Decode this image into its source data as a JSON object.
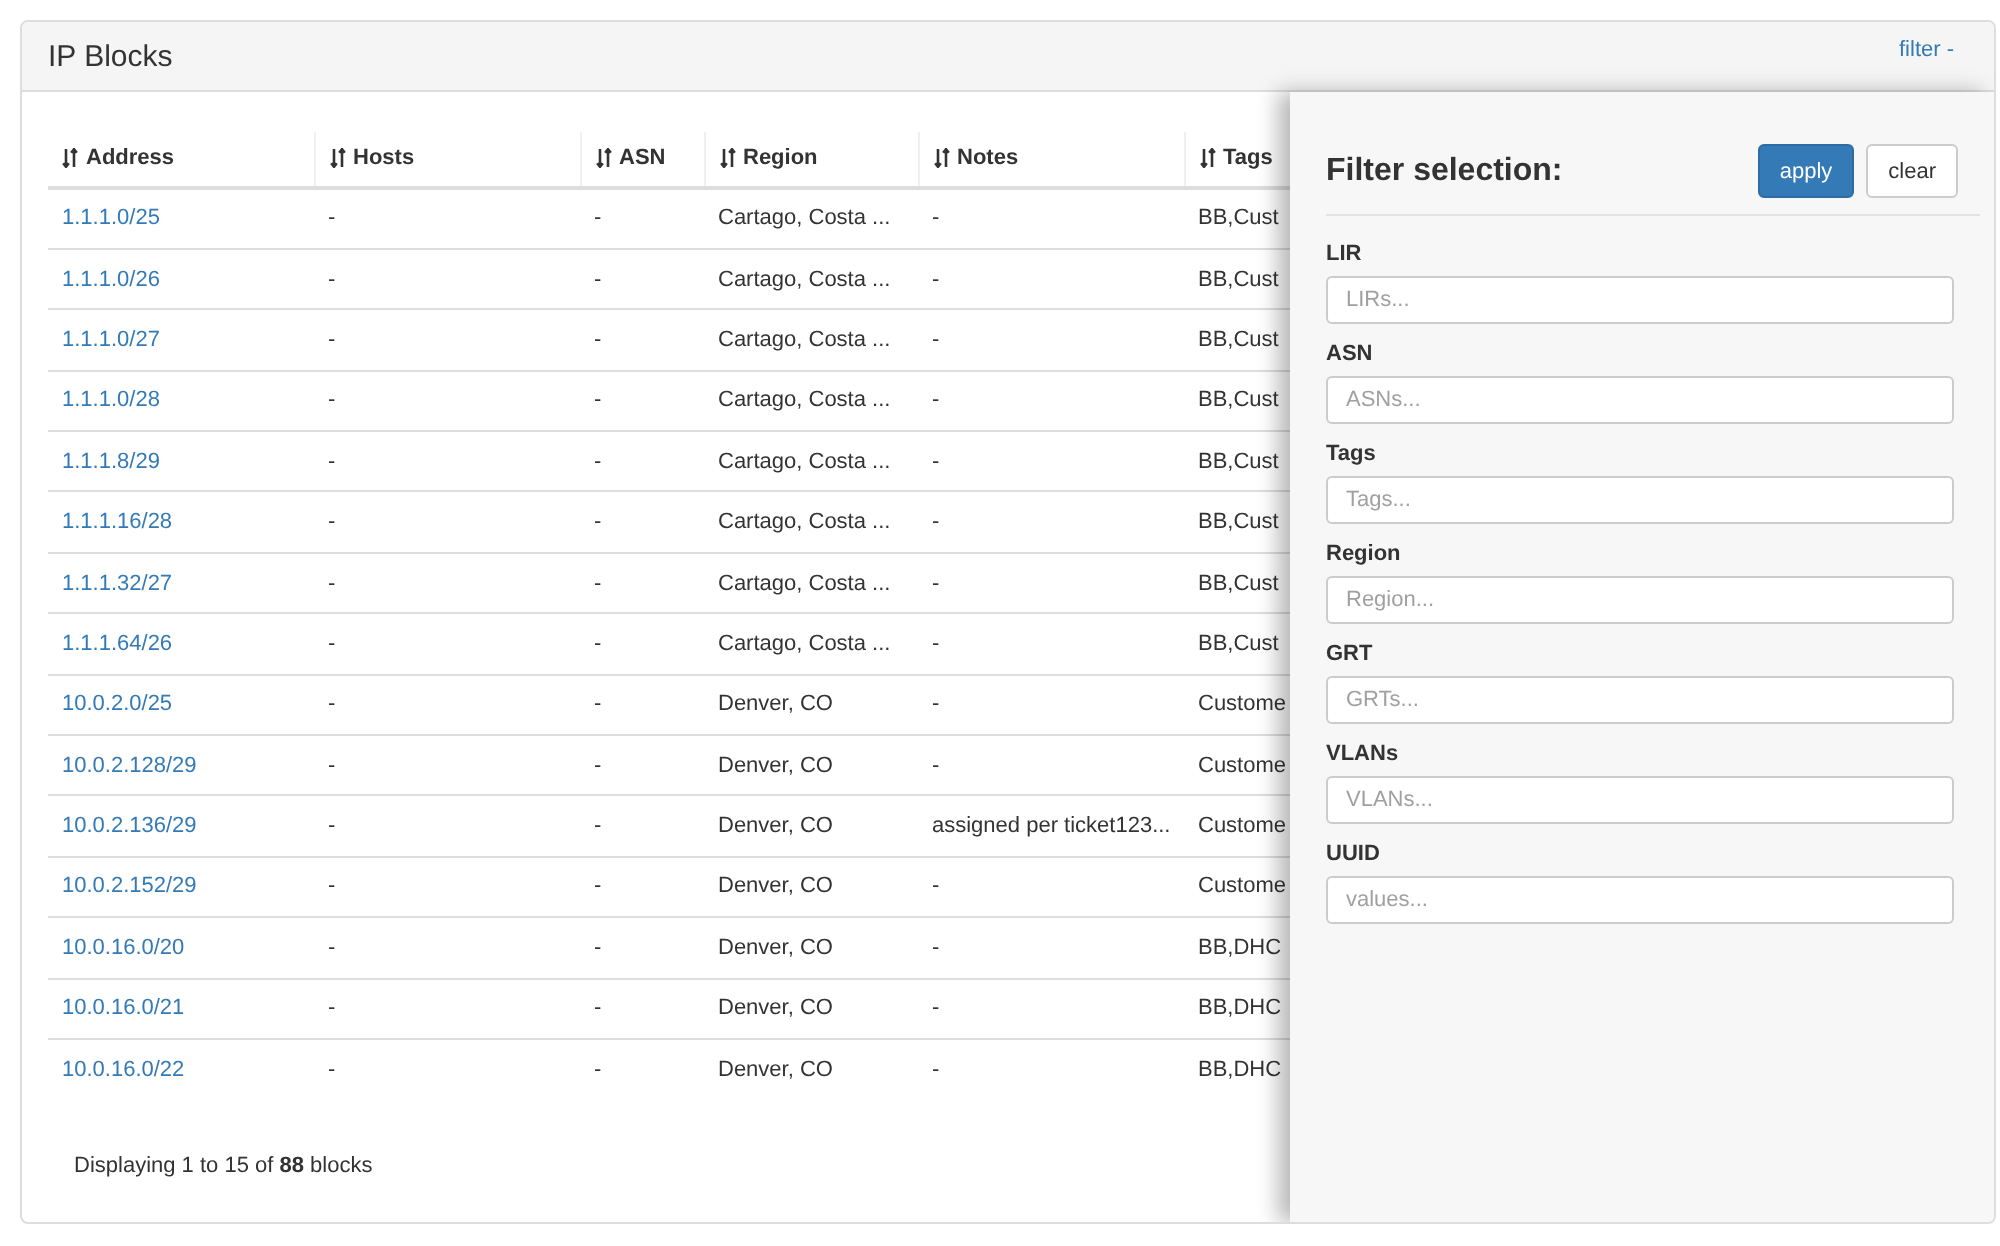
{
  "panel": {
    "title": "IP Blocks",
    "filter_toggle": "filter -"
  },
  "table": {
    "columns": [
      "Address",
      "Hosts",
      "ASN",
      "Region",
      "Notes",
      "Tags"
    ],
    "rows": [
      [
        "1.1.1.0/25",
        "-",
        "-",
        "Cartago, Costa ...",
        "-",
        "BB,Cust"
      ],
      [
        "1.1.1.0/26",
        "-",
        "-",
        "Cartago, Costa ...",
        "-",
        "BB,Cust"
      ],
      [
        "1.1.1.0/27",
        "-",
        "-",
        "Cartago, Costa ...",
        "-",
        "BB,Cust"
      ],
      [
        "1.1.1.0/28",
        "-",
        "-",
        "Cartago, Costa ...",
        "-",
        "BB,Cust"
      ],
      [
        "1.1.1.8/29",
        "-",
        "-",
        "Cartago, Costa ...",
        "-",
        "BB,Cust"
      ],
      [
        "1.1.1.16/28",
        "-",
        "-",
        "Cartago, Costa ...",
        "-",
        "BB,Cust"
      ],
      [
        "1.1.1.32/27",
        "-",
        "-",
        "Cartago, Costa ...",
        "-",
        "BB,Cust"
      ],
      [
        "1.1.1.64/26",
        "-",
        "-",
        "Cartago, Costa ...",
        "-",
        "BB,Cust"
      ],
      [
        "10.0.2.0/25",
        "-",
        "-",
        "Denver, CO",
        "-",
        "Custome"
      ],
      [
        "10.0.2.128/29",
        "-",
        "-",
        "Denver, CO",
        "-",
        "Custome"
      ],
      [
        "10.0.2.136/29",
        "-",
        "-",
        "Denver, CO",
        "assigned per ticket123...",
        "Custome"
      ],
      [
        "10.0.2.152/29",
        "-",
        "-",
        "Denver, CO",
        "-",
        "Custome"
      ],
      [
        "10.0.16.0/20",
        "-",
        "-",
        "Denver, CO",
        "-",
        "BB,DHC"
      ],
      [
        "10.0.16.0/21",
        "-",
        "-",
        "Denver, CO",
        "-",
        "BB,DHC"
      ],
      [
        "10.0.16.0/22",
        "-",
        "-",
        "Denver, CO",
        "-",
        "BB,DHC"
      ]
    ]
  },
  "footer": "Displaying 1 to 15 of **88** blocks",
  "filter_panel": {
    "title": "Filter selection:",
    "buttons": [
      {
        "label": "apply",
        "kind": "primary"
      },
      {
        "label": "clear",
        "kind": "default"
      }
    ],
    "fields": [
      {
        "label": "LIR",
        "placeholder": "LIRs..."
      },
      {
        "label": "ASN",
        "placeholder": "ASNs..."
      },
      {
        "label": "Tags",
        "placeholder": "Tags..."
      },
      {
        "label": "Region",
        "placeholder": "Region..."
      },
      {
        "label": "GRT",
        "placeholder": "GRTs..."
      },
      {
        "label": "VLANs",
        "placeholder": "VLANs..."
      },
      {
        "label": "UUID",
        "placeholder": "values..."
      }
    ]
  }
}
